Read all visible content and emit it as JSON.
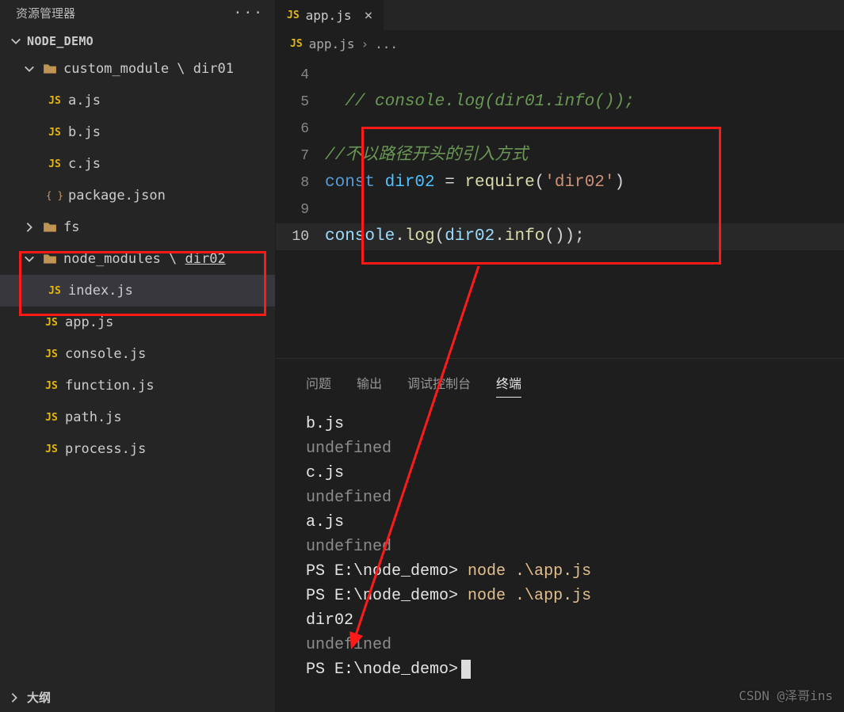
{
  "sidebar": {
    "title": "资源管理器",
    "folder": "NODE_DEMO",
    "outline": "大纲",
    "items": {
      "custom_module_dir01": "custom_module \\ dir01",
      "a_js": "a.js",
      "b_js": "b.js",
      "c_js": "c.js",
      "package_json": "package.json",
      "fs": "fs",
      "node_modules_dir02_a": "node_modules \\ ",
      "node_modules_dir02_b": "dir02",
      "index_js": "index.js",
      "app_js": "app.js",
      "console_js": "console.js",
      "function_js": "function.js",
      "path_js": "path.js",
      "process_js": "process.js"
    }
  },
  "tab": {
    "icon": "JS",
    "label": "app.js"
  },
  "breadcrumb": {
    "icon": "JS",
    "file": "app.js",
    "more": "..."
  },
  "code": {
    "lines": [
      "4",
      "5",
      "6",
      "7",
      "8",
      "9",
      "10"
    ],
    "l5_comment": "// console.log(dir01.info());",
    "l7_comment": "//不以路径开头的引入方式",
    "l8_const": "const ",
    "l8_var": "dir02",
    "l8_eq": " = ",
    "l8_req": "require",
    "l8_open": "(",
    "l8_str": "'dir02'",
    "l8_close": ")",
    "l10_console": "console",
    "l10_dot1": ".",
    "l10_log": "log",
    "l10_open": "(",
    "l10_dir": "dir02",
    "l10_dot2": ".",
    "l10_info": "info",
    "l10_rest": "());"
  },
  "panel": {
    "tabs": {
      "problems": "问题",
      "output": "输出",
      "debug": "调试控制台",
      "terminal": "终端"
    }
  },
  "term": {
    "l1": "b.js",
    "l2": "undefined",
    "l3": "c.js",
    "l4": "undefined",
    "l5": "a.js",
    "l6": "undefined",
    "l7a": "PS E:\\node_demo> ",
    "l7b": "node .\\app.js",
    "l8a": "PS E:\\node_demo> ",
    "l8b": "node .\\app.js",
    "l9": "dir02",
    "l10": "undefined",
    "l11": "PS E:\\node_demo>"
  },
  "watermark": "CSDN @泽哥ins"
}
